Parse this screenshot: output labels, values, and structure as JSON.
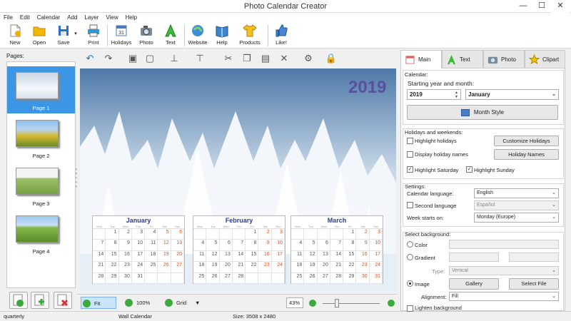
{
  "app": {
    "title": "Photo Calendar Creator",
    "min": "—",
    "max": "☐",
    "close": "✕"
  },
  "menu": [
    "File",
    "Edit",
    "Calendar",
    "Add",
    "Layer",
    "View",
    "Help"
  ],
  "toolbar": {
    "new": "New",
    "open": "Open",
    "save": "Save",
    "print": "Print",
    "holidays": "Holidays",
    "photo": "Photo",
    "text": "Text",
    "website": "Website",
    "help": "Help",
    "products": "Products",
    "like": "Like!"
  },
  "pages": {
    "label": "Pages:",
    "items": [
      "Page 1",
      "Page 2",
      "Page 3",
      "Page 4"
    ]
  },
  "canvas": {
    "year": "2019",
    "weekday_header": [
      "Mon",
      "Tue",
      "Wed",
      "Thu",
      "Fri",
      "Sat",
      "Sun"
    ],
    "months": [
      {
        "name": "January",
        "days": [
          "",
          "1",
          "2",
          "3",
          "4",
          "5",
          "6",
          "7",
          "8",
          "9",
          "10",
          "11",
          "12",
          "13",
          "14",
          "15",
          "16",
          "17",
          "18",
          "19",
          "20",
          "21",
          "22",
          "23",
          "24",
          "25",
          "26",
          "27",
          "28",
          "29",
          "30",
          "31",
          "",
          "",
          ""
        ]
      },
      {
        "name": "February",
        "days": [
          "",
          "",
          "",
          "",
          "1",
          "2",
          "3",
          "4",
          "5",
          "6",
          "7",
          "8",
          "9",
          "10",
          "11",
          "12",
          "13",
          "14",
          "15",
          "16",
          "17",
          "18",
          "19",
          "20",
          "21",
          "22",
          "23",
          "24",
          "25",
          "26",
          "27",
          "28",
          "",
          "",
          ""
        ]
      },
      {
        "name": "March",
        "days": [
          "",
          "",
          "",
          "",
          "1",
          "2",
          "3",
          "4",
          "5",
          "6",
          "7",
          "8",
          "9",
          "10",
          "11",
          "12",
          "13",
          "14",
          "15",
          "16",
          "17",
          "18",
          "19",
          "20",
          "21",
          "22",
          "23",
          "24",
          "25",
          "26",
          "27",
          "28",
          "29",
          "30",
          "31"
        ]
      }
    ]
  },
  "bottom": {
    "fit": "Fit",
    "zoom100": "100%",
    "grid": "Grid",
    "zoom_value": "43%"
  },
  "status": {
    "left": "quarterly",
    "type": "Wall Calendar",
    "size": "Size: 3508 x 2480"
  },
  "tabs": {
    "main": "Main",
    "text": "Text",
    "photo": "Photo",
    "clipart": "Clipart"
  },
  "panel": {
    "calendar": {
      "label": "Calendar:",
      "start_label": "Starting year and month:",
      "year": "2019",
      "month": "January",
      "month_style": "Month Style"
    },
    "holidays": {
      "label": "Holidays and weekends:",
      "highlight_holidays": "Highlight holidays",
      "display_names": "Display holiday names",
      "highlight_sat": "Highlight Saturday",
      "highlight_sun": "Highlight Sunday",
      "customize": "Customize Holidays",
      "holiday_names": "Holiday Names"
    },
    "settings": {
      "label": "Settings:",
      "lang_label": "Calendar language:",
      "lang_value": "English",
      "second_lang": "Second language",
      "second_value": "Español",
      "week_label": "Week starts on:",
      "week_value": "Monday (Europe)"
    },
    "background": {
      "label": "Select background:",
      "color": "Color",
      "gradient": "Gradient",
      "type_label": "Type:",
      "type_value": "Vertical",
      "image": "Image",
      "gallery": "Gallery",
      "select_file": "Select File",
      "alignment_label": "Alignment:",
      "alignment_value": "Fill",
      "lighten": "Lighten background"
    }
  }
}
